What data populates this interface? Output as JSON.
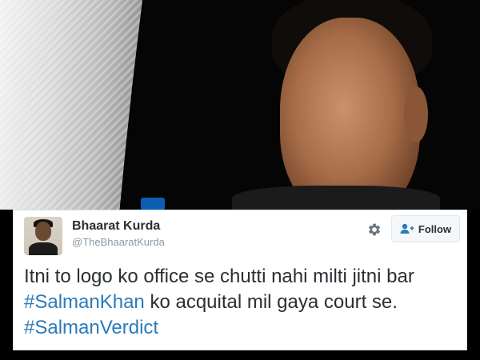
{
  "photo": {
    "description_icon": "photo"
  },
  "tweet": {
    "display_name": "Bhaarat Kurda",
    "handle": "@TheBhaaratKurda",
    "follow_label": "Follow",
    "line1": "Itni to logo ko office se chutti nahi milti jitni bar",
    "line2_hashtag": "#SalmanKhan",
    "line2_rest": " ko acquital mil gaya court se.",
    "line3_hashtag": "#SalmanVerdict"
  },
  "colors": {
    "hashtag": "#2b7bb9",
    "text": "#292f33",
    "muted": "#8899a6"
  },
  "icons": {
    "settings": "gear-icon",
    "follow": "add-user-icon"
  }
}
